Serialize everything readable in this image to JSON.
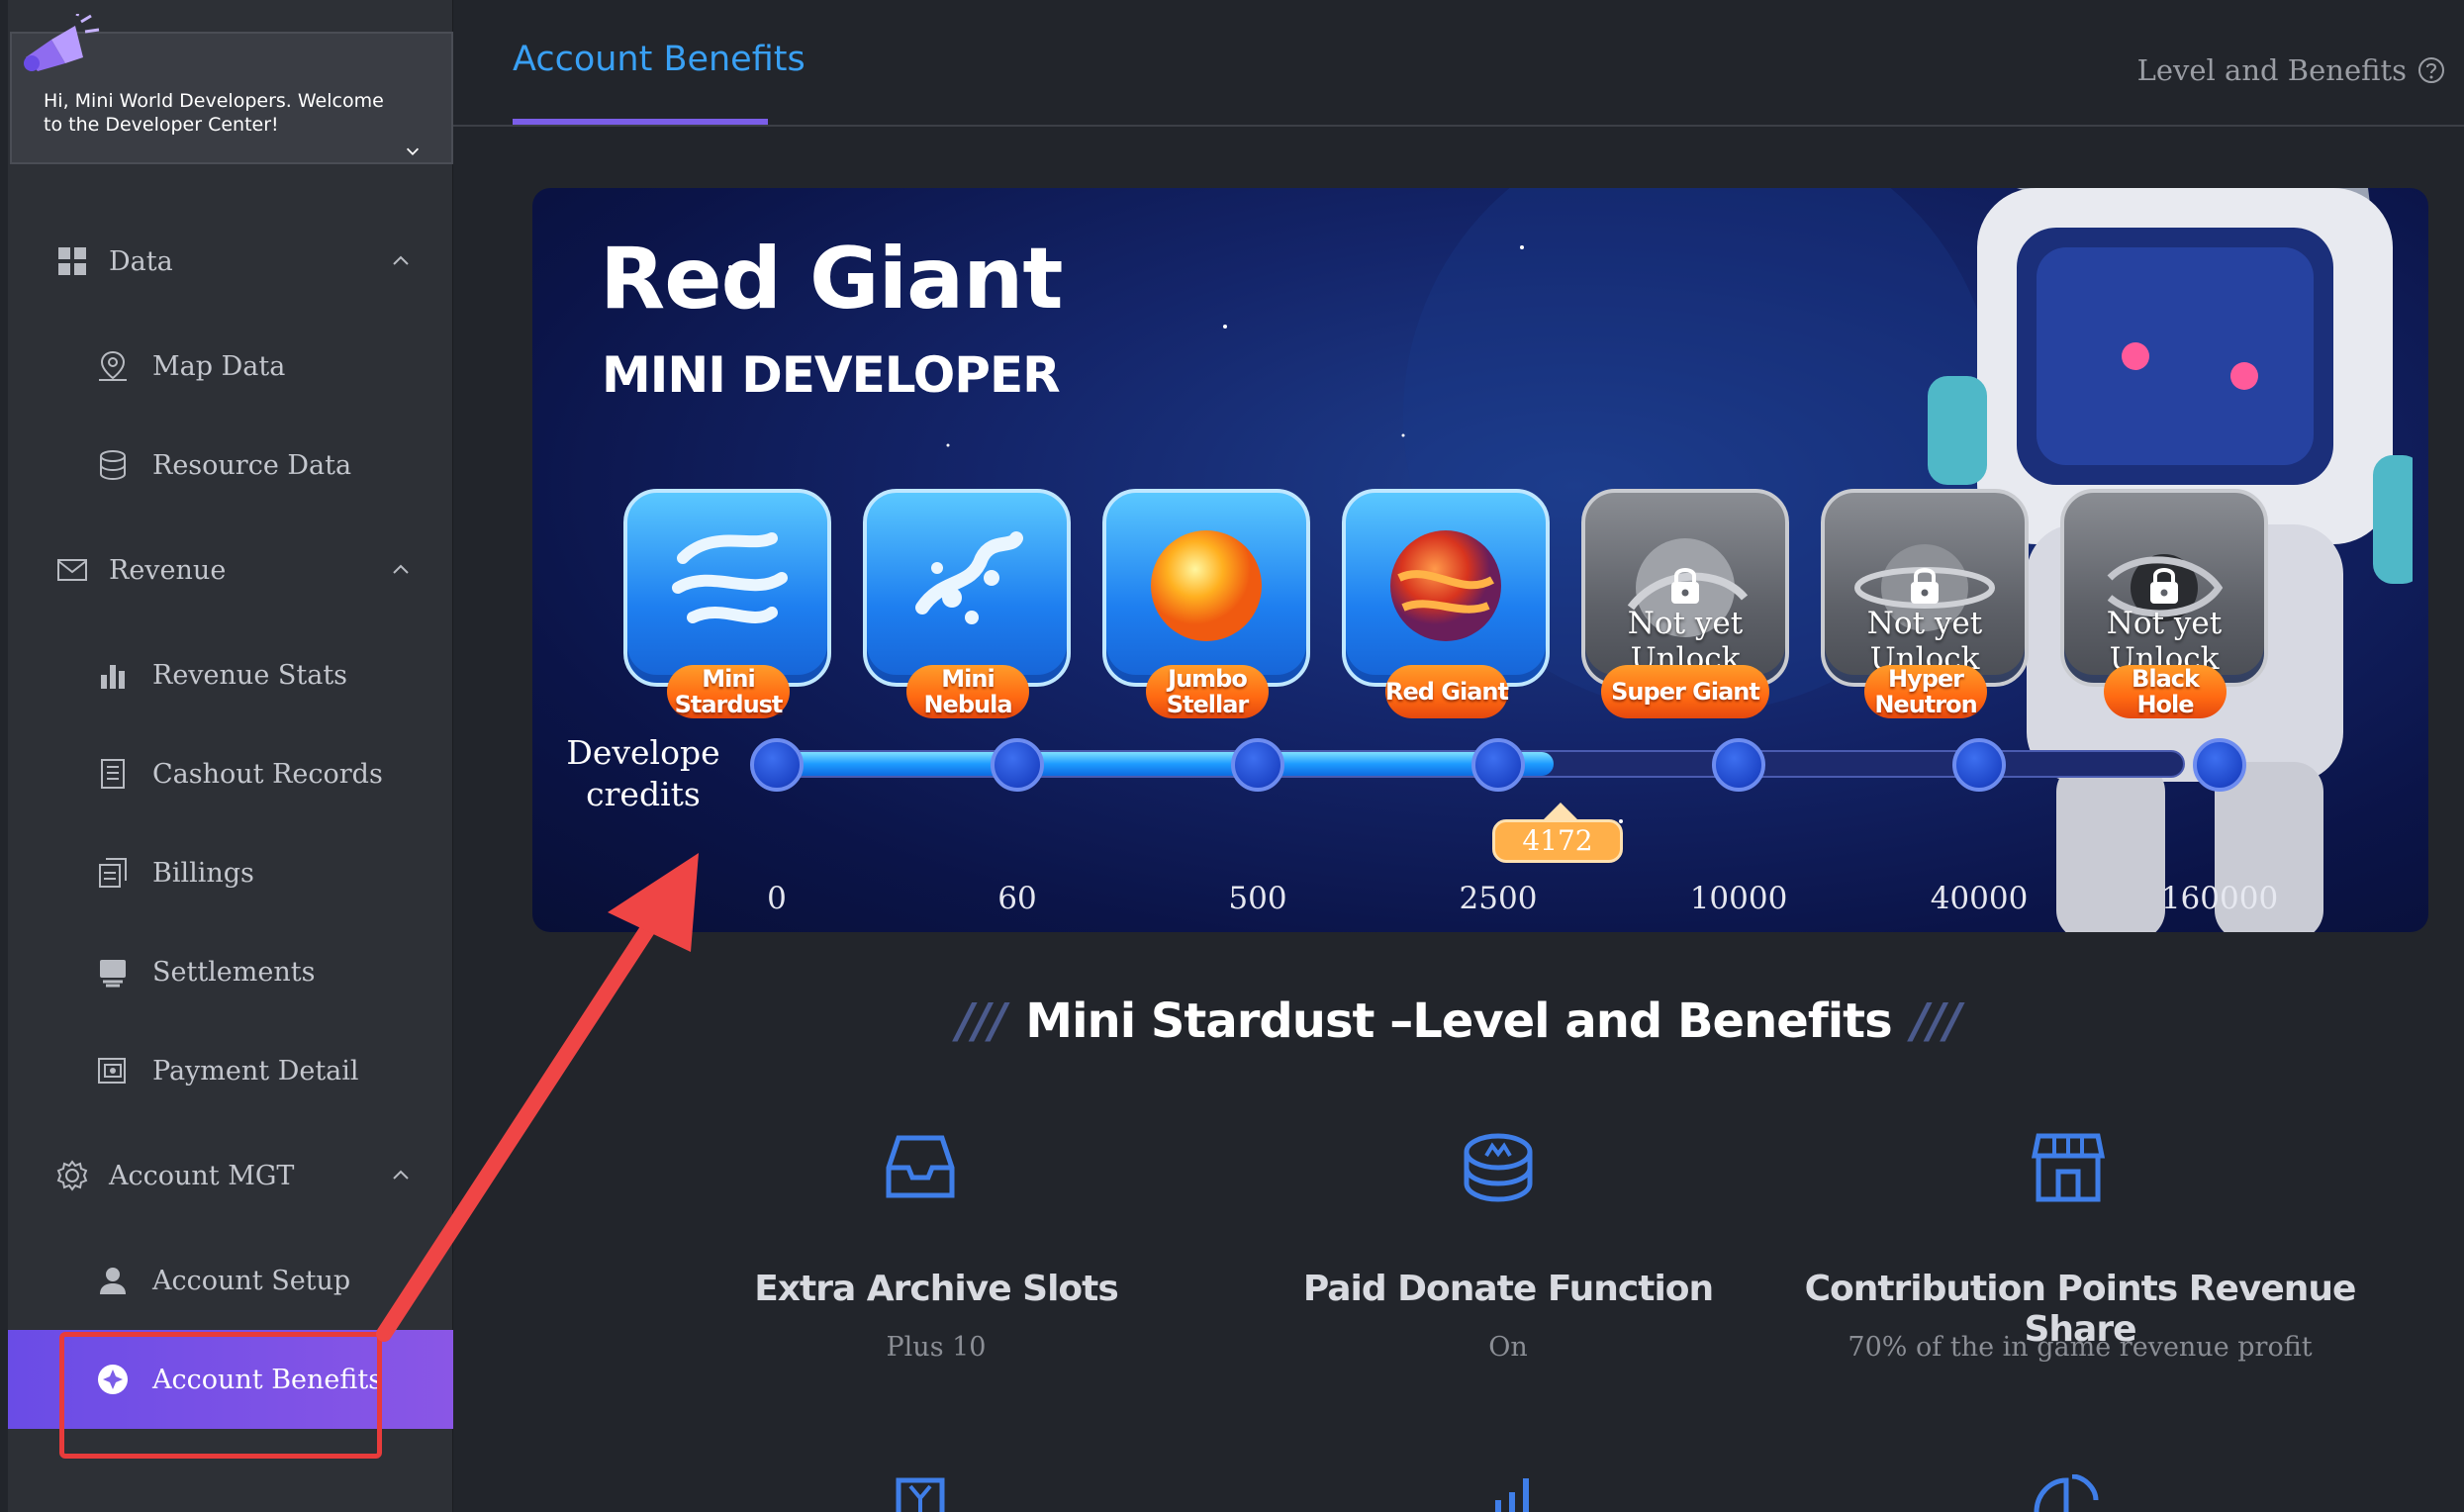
{
  "sidebar": {
    "welcome": "Hi, Mini World Developers. Welcome to the Developer Center!",
    "groups": [
      {
        "label": "Data",
        "icon": "grid-icon"
      },
      {
        "label": "Revenue",
        "icon": "mail-icon"
      },
      {
        "label": "Account MGT",
        "icon": "gear-icon"
      }
    ],
    "items": [
      {
        "label": "Map Data",
        "icon": "map-pin-icon"
      },
      {
        "label": "Resource Data",
        "icon": "database-icon"
      },
      {
        "label": "Revenue Stats",
        "icon": "bar-chart-icon"
      },
      {
        "label": "Cashout Records",
        "icon": "document-icon"
      },
      {
        "label": "Billings",
        "icon": "bill-icon"
      },
      {
        "label": "Settlements",
        "icon": "settlement-icon"
      },
      {
        "label": "Payment Detail",
        "icon": "payment-icon"
      },
      {
        "label": "Account Setup",
        "icon": "user-icon"
      },
      {
        "label": "Account Benefits",
        "icon": "benefits-icon",
        "active": true
      }
    ]
  },
  "header": {
    "tab": "Account Benefits",
    "level_link": "Level and Benefits"
  },
  "banner": {
    "title": "Red Giant",
    "subtitle": "MINI DEVELOPER",
    "credits_label": "Develope credits",
    "current_value": "4172",
    "progress_value": 4172,
    "levels": [
      {
        "name": "Mini Stardust",
        "threshold": "0",
        "unlocked": true
      },
      {
        "name": "Mini Nebula",
        "threshold": "60",
        "unlocked": true
      },
      {
        "name": "Jumbo Stellar",
        "threshold": "500",
        "unlocked": true
      },
      {
        "name": "Red Giant",
        "threshold": "2500",
        "unlocked": true
      },
      {
        "name": "Super Giant",
        "threshold": "10000",
        "unlocked": false
      },
      {
        "name": "Hyper Neutron",
        "threshold": "40000",
        "unlocked": false
      },
      {
        "name": "Black Hole",
        "threshold": "160000",
        "unlocked": false
      }
    ],
    "lock_text": "Not yet Unlock"
  },
  "section": {
    "title": "Mini Stardust –Level and Benefits",
    "benefits": [
      {
        "title": "Extra Archive Slots",
        "desc": "Plus 10",
        "icon": "archive-tray-icon"
      },
      {
        "title": "Paid Donate Function",
        "desc": "On",
        "icon": "coin-stack-icon"
      },
      {
        "title": "Contribution Points Revenue Share",
        "desc": "70% of the in game revenue profit",
        "icon": "store-icon"
      }
    ]
  },
  "colors": {
    "accent": "#7b5ee8",
    "tab_text": "#39a0f4",
    "annotation": "#e83b3b"
  }
}
